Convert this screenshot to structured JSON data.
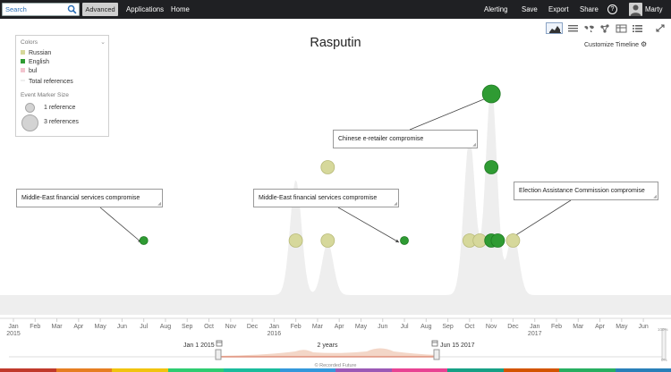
{
  "topbar": {
    "search_placeholder": "Search",
    "advanced_label": "Advanced",
    "applications_label": "Applications",
    "home_label": "Home",
    "alerting_label": "Alerting",
    "save_label": "Save",
    "export_label": "Export",
    "share_label": "Share",
    "help_glyph": "?",
    "user_name": "Marty"
  },
  "view_toolbar": [
    "timeline-view-icon",
    "list-view-icon",
    "map-view-icon",
    "network-view-icon",
    "table-view-icon",
    "details-view-icon",
    "expand-icon"
  ],
  "customize_label": "Customize Timeline",
  "legend": {
    "colors_title": "Colors",
    "items": [
      {
        "label": "Russian",
        "color": "#d6d89b"
      },
      {
        "label": "English",
        "color": "#2f9b33"
      },
      {
        "label": "bul",
        "color": "#f3c5cf"
      },
      {
        "label": "Total references",
        "color": "#eeeeee"
      }
    ],
    "marker_size_title": "Event Marker Size",
    "marker_small_label": "1 reference",
    "marker_big_label": "3 references"
  },
  "callouts": [
    {
      "text": "Middle-East financial services compromise"
    },
    {
      "text": "Middle-East financial services compromise"
    },
    {
      "text": "Chinese e-retailer compromise"
    },
    {
      "text": "Election Assistance Commission compromise"
    }
  ],
  "range": {
    "start_label": "Jan 1 2015",
    "duration_label": "2 years",
    "end_label": "Jun 15 2017",
    "zoom_top": "100%",
    "zoom_bottom": "0%"
  },
  "footer": "© Recorded Future",
  "chart_data": {
    "type": "timeline",
    "title": "Rasputin",
    "x_ticks": [
      {
        "month": "Jan",
        "year": "2015"
      },
      {
        "month": "Feb",
        "year": ""
      },
      {
        "month": "Mar",
        "year": ""
      },
      {
        "month": "Apr",
        "year": ""
      },
      {
        "month": "May",
        "year": ""
      },
      {
        "month": "Jun",
        "year": ""
      },
      {
        "month": "Jul",
        "year": ""
      },
      {
        "month": "Aug",
        "year": ""
      },
      {
        "month": "Sep",
        "year": ""
      },
      {
        "month": "Oct",
        "year": ""
      },
      {
        "month": "Nov",
        "year": ""
      },
      {
        "month": "Dec",
        "year": ""
      },
      {
        "month": "Jan",
        "year": "2016"
      },
      {
        "month": "Feb",
        "year": ""
      },
      {
        "month": "Mar",
        "year": ""
      },
      {
        "month": "Apr",
        "year": ""
      },
      {
        "month": "May",
        "year": ""
      },
      {
        "month": "Jun",
        "year": ""
      },
      {
        "month": "Jul",
        "year": ""
      },
      {
        "month": "Aug",
        "year": ""
      },
      {
        "month": "Sep",
        "year": ""
      },
      {
        "month": "Oct",
        "year": ""
      },
      {
        "month": "Nov",
        "year": ""
      },
      {
        "month": "Dec",
        "year": ""
      },
      {
        "month": "Jan",
        "year": "2017"
      },
      {
        "month": "Feb",
        "year": ""
      },
      {
        "month": "Mar",
        "year": ""
      },
      {
        "month": "Apr",
        "year": ""
      },
      {
        "month": "May",
        "year": ""
      },
      {
        "month": "Jun",
        "year": ""
      }
    ],
    "events": [
      {
        "date": "2015-07-01",
        "lang": "English",
        "refs": 1,
        "row": 0
      },
      {
        "date": "2016-02-01",
        "lang": "Russian",
        "refs": 1,
        "row": 0
      },
      {
        "date": "2016-03-15",
        "lang": "Russian",
        "refs": 1,
        "row": 0
      },
      {
        "date": "2016-03-15",
        "lang": "Russian",
        "refs": 1,
        "row": 1
      },
      {
        "date": "2016-07-01",
        "lang": "English",
        "refs": 1,
        "row": 0
      },
      {
        "date": "2016-10-01",
        "lang": "Russian",
        "refs": 1,
        "row": 0
      },
      {
        "date": "2016-10-15",
        "lang": "Russian",
        "refs": 1,
        "row": 0
      },
      {
        "date": "2016-11-01",
        "lang": "English",
        "refs": 1,
        "row": 0
      },
      {
        "date": "2016-11-10",
        "lang": "English",
        "refs": 1,
        "row": 0
      },
      {
        "date": "2016-11-01",
        "lang": "English",
        "refs": 1,
        "row": 1
      },
      {
        "date": "2016-11-01",
        "lang": "English",
        "refs": 3,
        "row": 2
      },
      {
        "date": "2016-12-01",
        "lang": "Russian",
        "refs": 1,
        "row": 0
      }
    ],
    "total_references_peaks": [
      {
        "date": "2016-02-01",
        "level": 0.55
      },
      {
        "date": "2016-03-15",
        "level": 0.25
      },
      {
        "date": "2016-10-01",
        "level": 0.75
      },
      {
        "date": "2016-11-01",
        "level": 1.0
      },
      {
        "date": "2016-12-01",
        "level": 0.3
      }
    ]
  }
}
